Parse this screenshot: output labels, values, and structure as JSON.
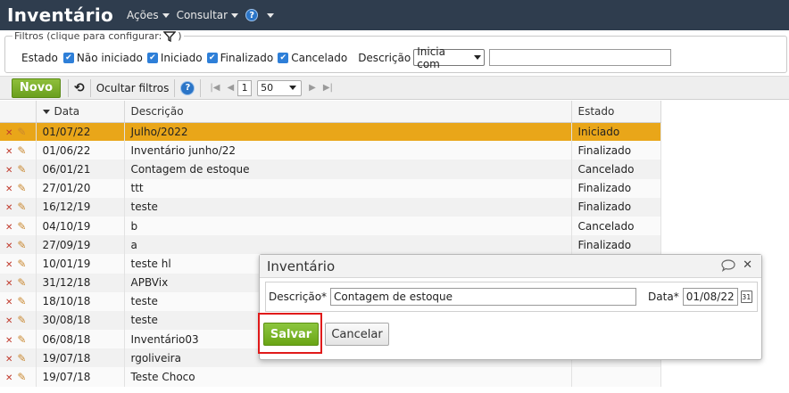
{
  "header": {
    "title": "Inventário",
    "menu": [
      {
        "label": "Ações"
      },
      {
        "label": "Consultar"
      }
    ],
    "help_symbol": "?"
  },
  "filters": {
    "legend": "Filtros (clique para configurar:",
    "legend_close": ")",
    "estado_label": "Estado",
    "checkboxes": [
      "Não iniciado",
      "Iniciado",
      "Finalizado",
      "Cancelado"
    ],
    "descricao_label": "Descrição",
    "descricao_mode": "Inicia com",
    "descricao_value": ""
  },
  "toolbar": {
    "novo_label": "Novo",
    "hide_filters_label": "Ocultar filtros",
    "page": "1",
    "page_size": "50"
  },
  "grid": {
    "columns": [
      "Data",
      "Descrição",
      "Estado"
    ],
    "rows": [
      {
        "data": "01/07/22",
        "descricao": "Julho/2022",
        "estado": "Iniciado"
      },
      {
        "data": "01/06/22",
        "descricao": "Inventário junho/22",
        "estado": "Finalizado"
      },
      {
        "data": "06/01/21",
        "descricao": "Contagem de estoque",
        "estado": "Cancelado"
      },
      {
        "data": "27/01/20",
        "descricao": "ttt",
        "estado": "Finalizado"
      },
      {
        "data": "16/12/19",
        "descricao": "teste",
        "estado": "Finalizado"
      },
      {
        "data": "04/10/19",
        "descricao": "b",
        "estado": "Cancelado"
      },
      {
        "data": "27/09/19",
        "descricao": "a",
        "estado": "Finalizado"
      },
      {
        "data": "10/01/19",
        "descricao": "teste hl",
        "estado": ""
      },
      {
        "data": "31/12/18",
        "descricao": "APBVix",
        "estado": ""
      },
      {
        "data": "18/10/18",
        "descricao": "teste",
        "estado": ""
      },
      {
        "data": "30/08/18",
        "descricao": "teste",
        "estado": ""
      },
      {
        "data": "06/08/18",
        "descricao": "Inventário03",
        "estado": ""
      },
      {
        "data": "19/07/18",
        "descricao": "rgoliveira",
        "estado": ""
      },
      {
        "data": "19/07/18",
        "descricao": "Teste Choco",
        "estado": ""
      }
    ]
  },
  "dialog": {
    "title": "Inventário",
    "descricao_label": "Descrição*",
    "descricao_value": "Contagem de estoque",
    "data_label": "Data*",
    "data_value": "01/08/22",
    "save_label": "Salvar",
    "cancel_label": "Cancelar"
  },
  "colors": {
    "topbar": "#2f3d4e",
    "selected_row": "#e9a619",
    "save_green": "#7ab52a",
    "highlight_red": "#e01a1a"
  }
}
